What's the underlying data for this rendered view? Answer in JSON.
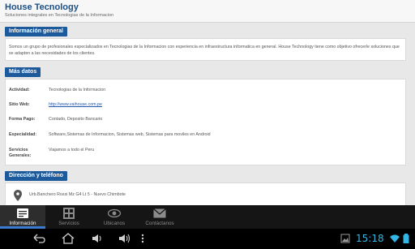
{
  "header": {
    "title": "House Tecnology",
    "subtitle": "Soluciones integrales en Tecnologias de la Informacion"
  },
  "about": {
    "heading": "Información general",
    "text": "Somos un grupo de profesionales especializados en Tecnologias de la Informacion con experiencia en infraestructura informatica en general. House Technology tiene como objetivo ofrecerle soluciones que se adapten a las necesidades de los clientes."
  },
  "details": {
    "heading": "Más datos",
    "rows": [
      {
        "label": "Actividad:",
        "value": "Tecnologias de la Informacion"
      },
      {
        "label": "Sitio Web:",
        "value": "http://www.vaihouse.com.pe"
      },
      {
        "label": "Forma Pago:",
        "value": "Contado, Deposito Bancario"
      },
      {
        "label": "Especialidad:",
        "value": "Software,Sistemas de Informacion, Sistemas web, Sistemas para moviles en Android"
      },
      {
        "label": "Servicios",
        "label2": "Generales:",
        "value": "Viajamos a todo el Peru"
      }
    ]
  },
  "contact": {
    "heading": "Dirección y teléfono",
    "address": "Urb.Banchero Rossi Mz G4 Lt 5 - Nuevo Chimbote"
  },
  "tabs": [
    {
      "label": "Información",
      "icon": "info-card-icon"
    },
    {
      "label": "Servicios",
      "icon": "grid-icon"
    },
    {
      "label": "Ubicanos",
      "icon": "eye-icon"
    },
    {
      "label": "Contáctanos",
      "icon": "envelope-icon"
    }
  ],
  "status": {
    "clock": "15:18"
  },
  "colors": {
    "accent": "#1c5a9c",
    "tab_bar": "#151515",
    "clock": "#33b5e5"
  }
}
